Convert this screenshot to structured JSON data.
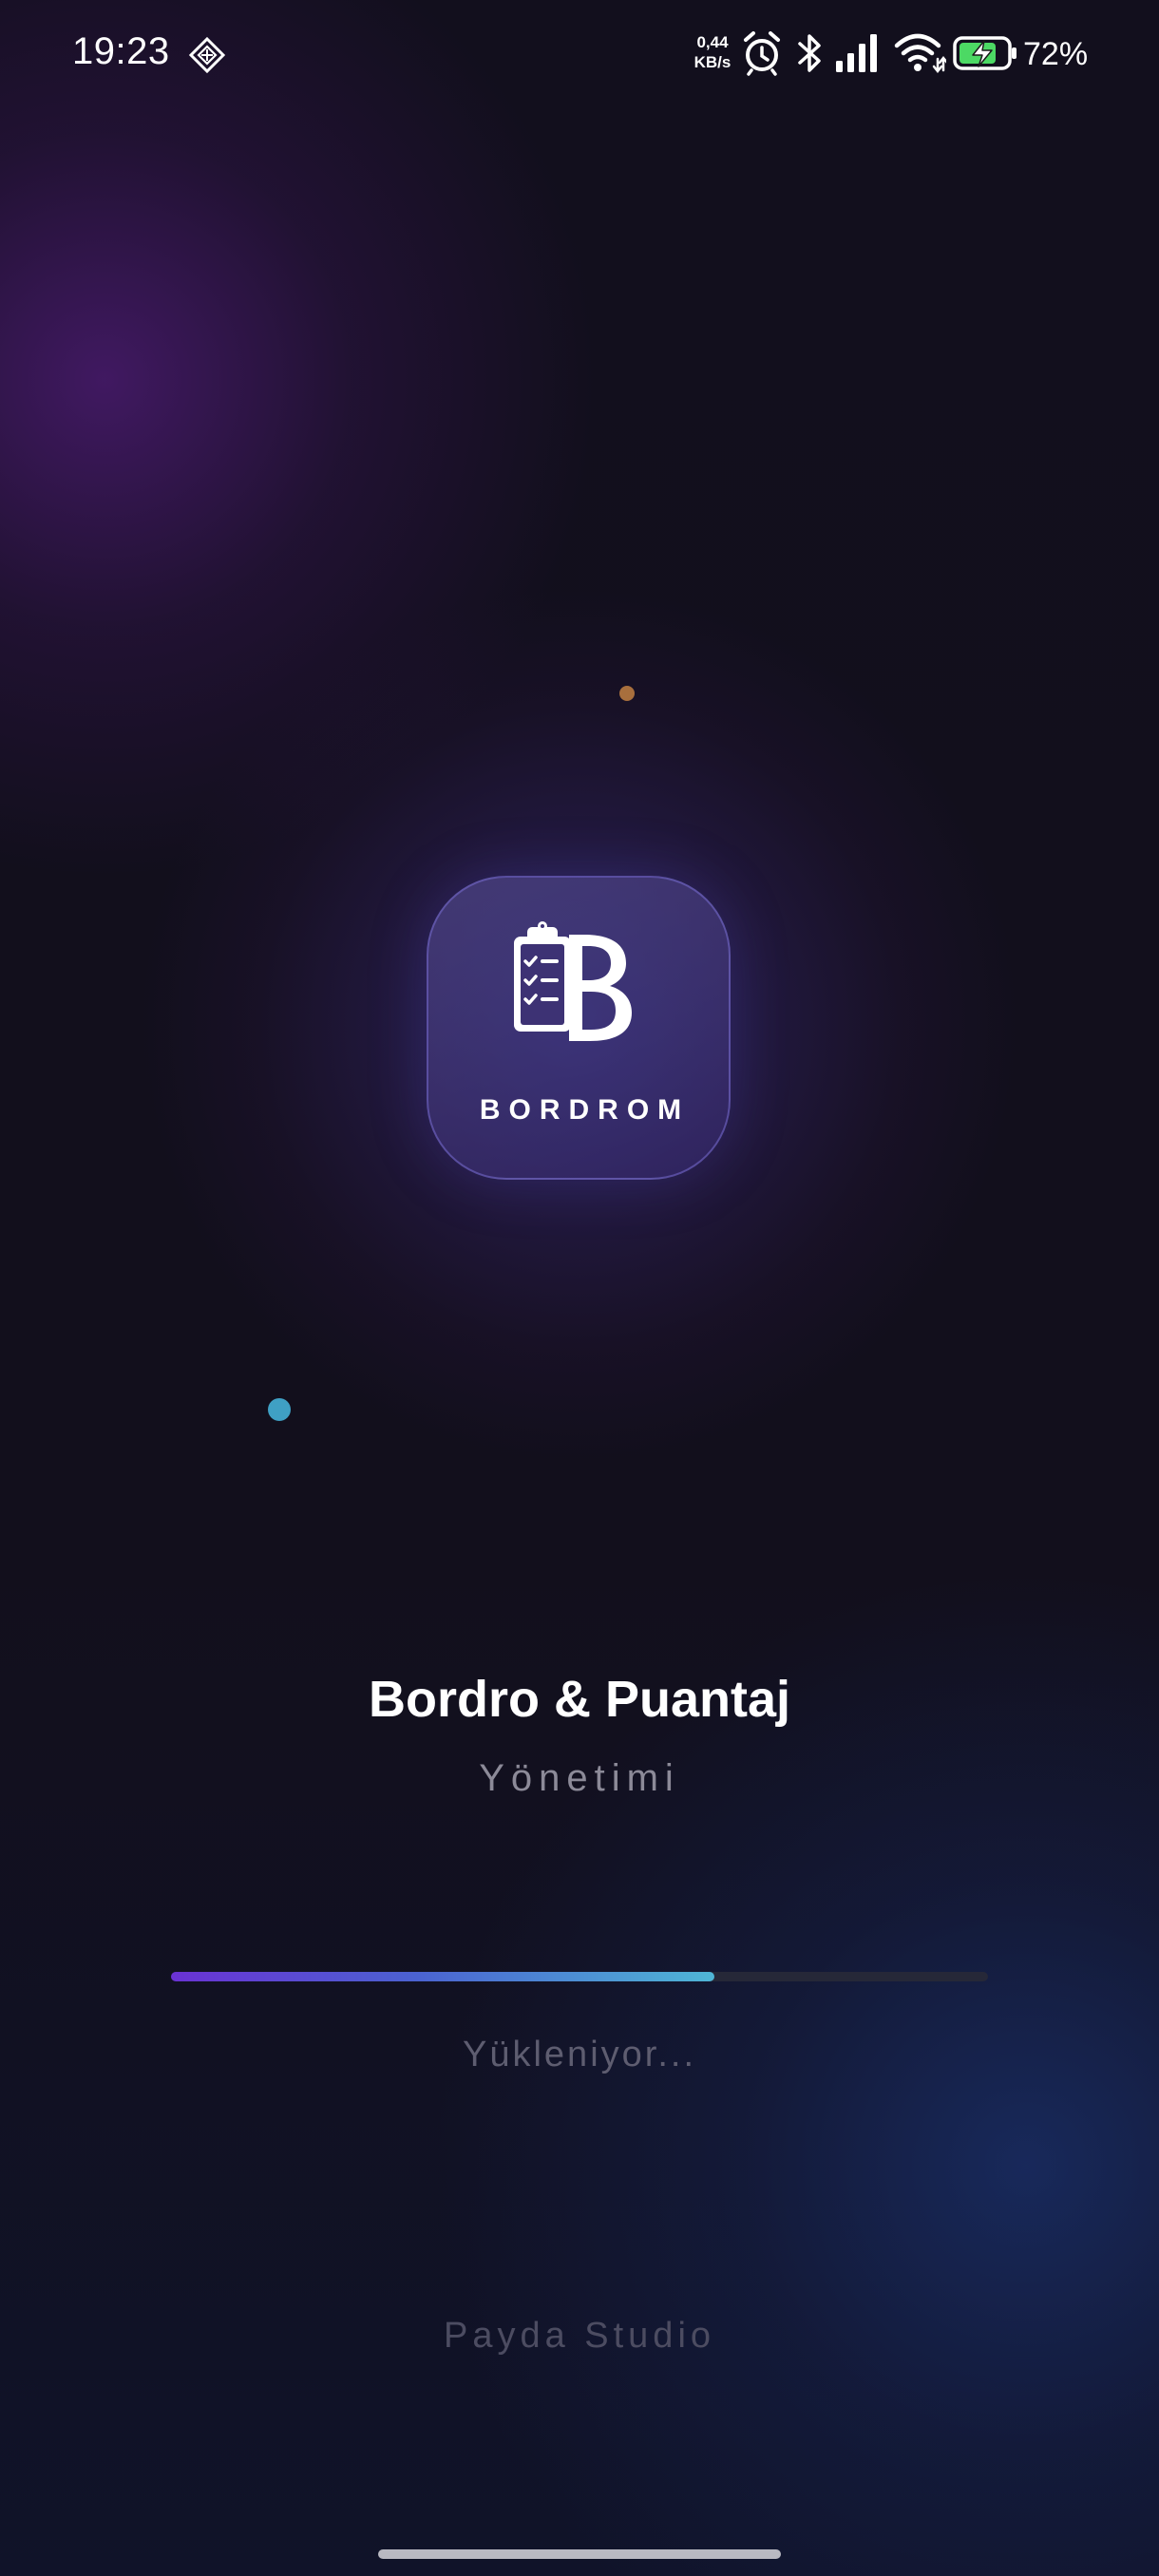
{
  "status_bar": {
    "time": "19:23",
    "net_speed_value": "0,44",
    "net_speed_unit": "KB/s",
    "battery_percent": "72%",
    "icons": [
      "maps-diamond-icon",
      "alarm-icon",
      "bluetooth-icon",
      "signal-icon",
      "wifi-icon",
      "battery-charging-icon"
    ]
  },
  "logo": {
    "wordmark": "BORDROM",
    "icon": "clipboard-checklist-b-icon"
  },
  "app": {
    "title": "Bordro & Puantaj",
    "subtitle": "Yönetimi"
  },
  "progress": {
    "fraction": 0.665,
    "label": "Yükleniyor..."
  },
  "footer": {
    "studio": "Payda Studio"
  },
  "colors": {
    "background": "#110f1c",
    "progress_start": "#6a32d4",
    "progress_end": "#4fb6d6",
    "accent_orange_dot": "#a86f3d",
    "accent_teal_dot": "#3fa0c4"
  }
}
